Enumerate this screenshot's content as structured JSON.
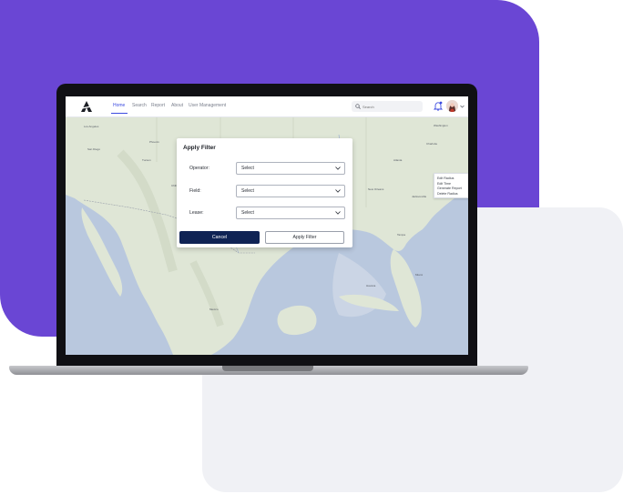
{
  "nav": {
    "items": [
      "Home",
      "Search",
      "Report",
      "About",
      "User Management"
    ],
    "search_placeholder": "Search"
  },
  "map_labels": [
    "Los Angeles",
    "Phoenix",
    "San Diego",
    "Tucson",
    "Chihuahua",
    "Monterrey",
    "Houston",
    "Dallas",
    "New Orleans",
    "Atlanta",
    "Jacksonville",
    "Tampa",
    "Miami",
    "Havana",
    "Mexico",
    "Washington",
    "Charlotte"
  ],
  "context_menu": {
    "items": [
      "Edit Radius",
      "Edit Time",
      "Generate Report",
      "Delete Radius"
    ]
  },
  "modal": {
    "title": "Apply Filter",
    "fields": [
      {
        "label": "Operator:",
        "value": "Select"
      },
      {
        "label": "Field:",
        "value": "Select"
      },
      {
        "label": "Lease:",
        "value": "Select"
      }
    ],
    "cancel_label": "Cancel",
    "apply_label": "Apply Filter"
  },
  "colors": {
    "purple_panel": "#6a46d4",
    "grey_panel": "#f0f1f5",
    "nav_active": "#3c4be0",
    "cancel_button": "#0f2354",
    "land": "#dfe6d6",
    "water": "#b9c8de"
  }
}
